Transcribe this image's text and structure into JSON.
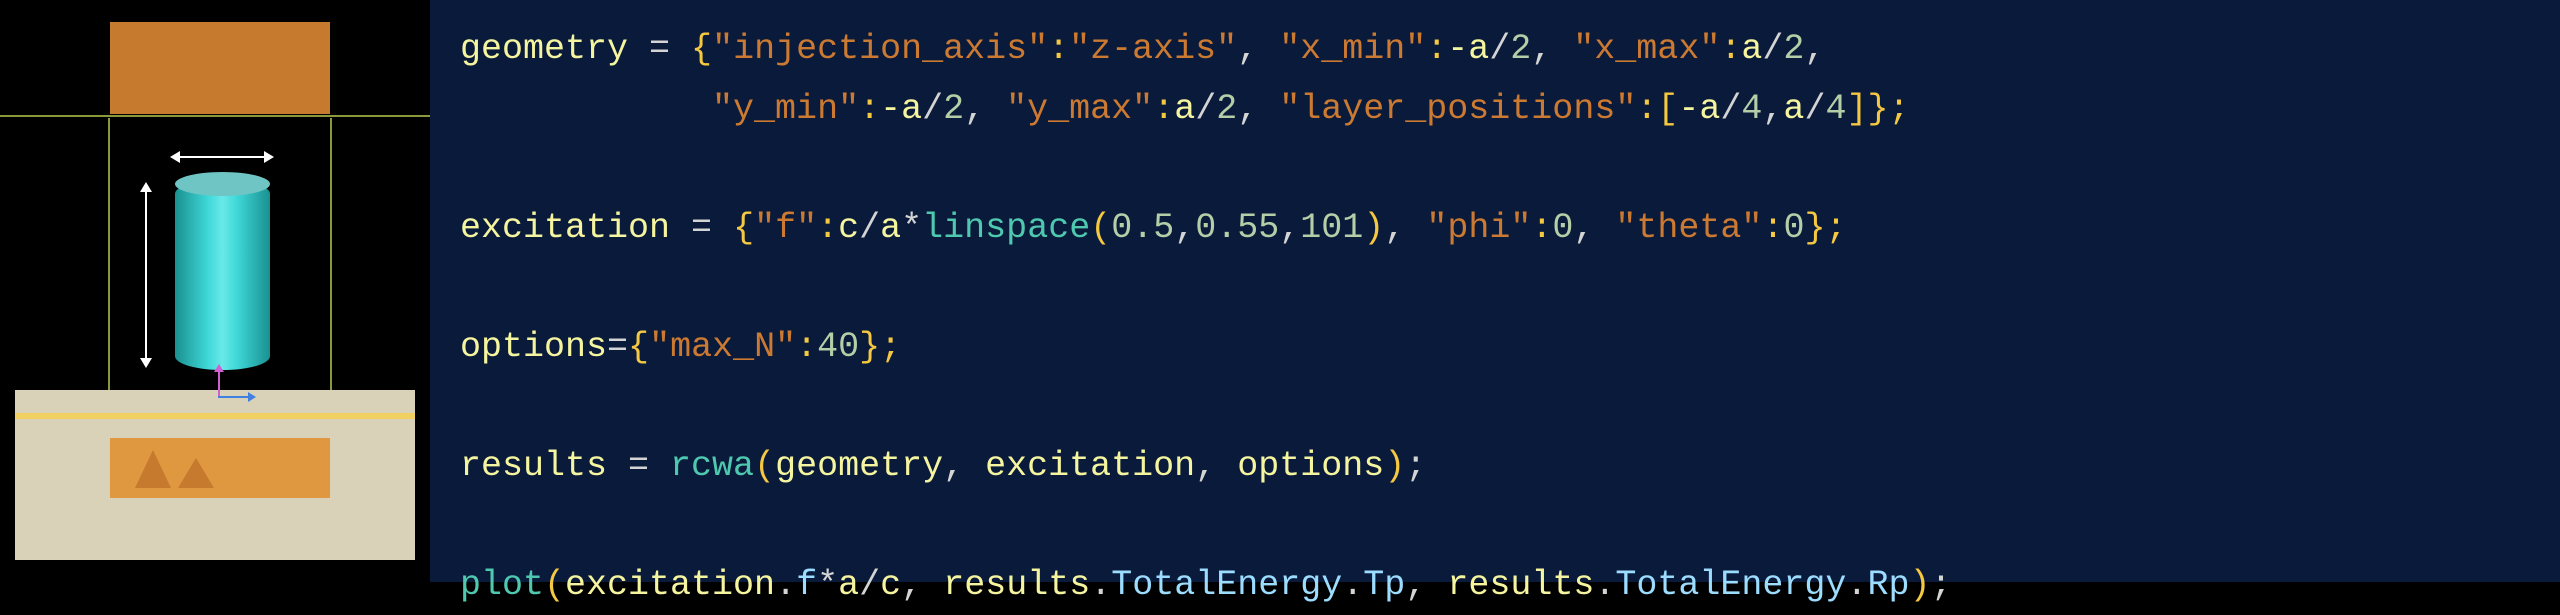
{
  "code": {
    "line1": {
      "var": "geometry",
      "assign": " = ",
      "open": "{",
      "k1": "\"injection_axis\"",
      "c1": ":",
      "v1": "\"z-axis\"",
      "s1": ", ",
      "k2": "\"x_min\"",
      "c2": ":",
      "v2a": "-a",
      "v2b": "/",
      "v2c": "2",
      "s2": ", ",
      "k3": "\"x_max\"",
      "c3": ":",
      "v3a": "a",
      "v3b": "/",
      "v3c": "2",
      "s3": ","
    },
    "line2": {
      "indent": "            ",
      "k1": "\"y_min\"",
      "c1": ":",
      "v1a": "-a",
      "v1b": "/",
      "v1c": "2",
      "s1": ", ",
      "k2": "\"y_max\"",
      "c2": ":",
      "v2a": "a",
      "v2b": "/",
      "v2c": "2",
      "s2": ", ",
      "k3": "\"layer_positions\"",
      "c3": ":",
      "open": "[",
      "v3a": "-a",
      "v3b": "/",
      "v3c": "4",
      "s3": ",",
      "v4a": "a",
      "v4b": "/",
      "v4c": "4",
      "close": "]",
      "end": "};"
    },
    "line4": {
      "var": "excitation",
      "assign": " = ",
      "open": "{",
      "k1": "\"f\"",
      "c1": ":",
      "v1a": "c",
      "v1b": "/",
      "v1c": "a",
      "v1d": "*",
      "fn": "linspace",
      "po": "(",
      "a1": "0.5",
      "ac1": ",",
      "a2": "0.55",
      "ac2": ",",
      "a3": "101",
      "pc": ")",
      "s1": ", ",
      "k2": "\"phi\"",
      "c2": ":",
      "v2": "0",
      "s2": ", ",
      "k3": "\"theta\"",
      "c3": ":",
      "v3": "0",
      "end": "};"
    },
    "line6": {
      "var": "options",
      "assign": "=",
      "open": "{",
      "k1": "\"max_N\"",
      "c1": ":",
      "v1": "40",
      "end": "};"
    },
    "line8": {
      "var": "results",
      "assign": " = ",
      "fn": "rcwa",
      "po": "(",
      "a1": "geometry",
      "c1": ", ",
      "a2": "excitation",
      "c2": ", ",
      "a3": "options",
      "pc": ")",
      "end": ";"
    },
    "line10": {
      "fn": "plot",
      "po": "(",
      "a1a": "excitation",
      "a1b": ".",
      "a1c": "f",
      "a1d": "*",
      "a1e": "a",
      "a1f": "/",
      "a1g": "c",
      "c1": ", ",
      "a2a": "results",
      "a2b": ".",
      "a2c": "TotalEnergy",
      "a2d": ".",
      "a2e": "Tp",
      "c2": ", ",
      "a3a": "results",
      "a3b": ".",
      "a3c": "TotalEnergy",
      "a3d": ".",
      "a3e": "Rp",
      "pc": ")",
      "end": ";"
    }
  }
}
